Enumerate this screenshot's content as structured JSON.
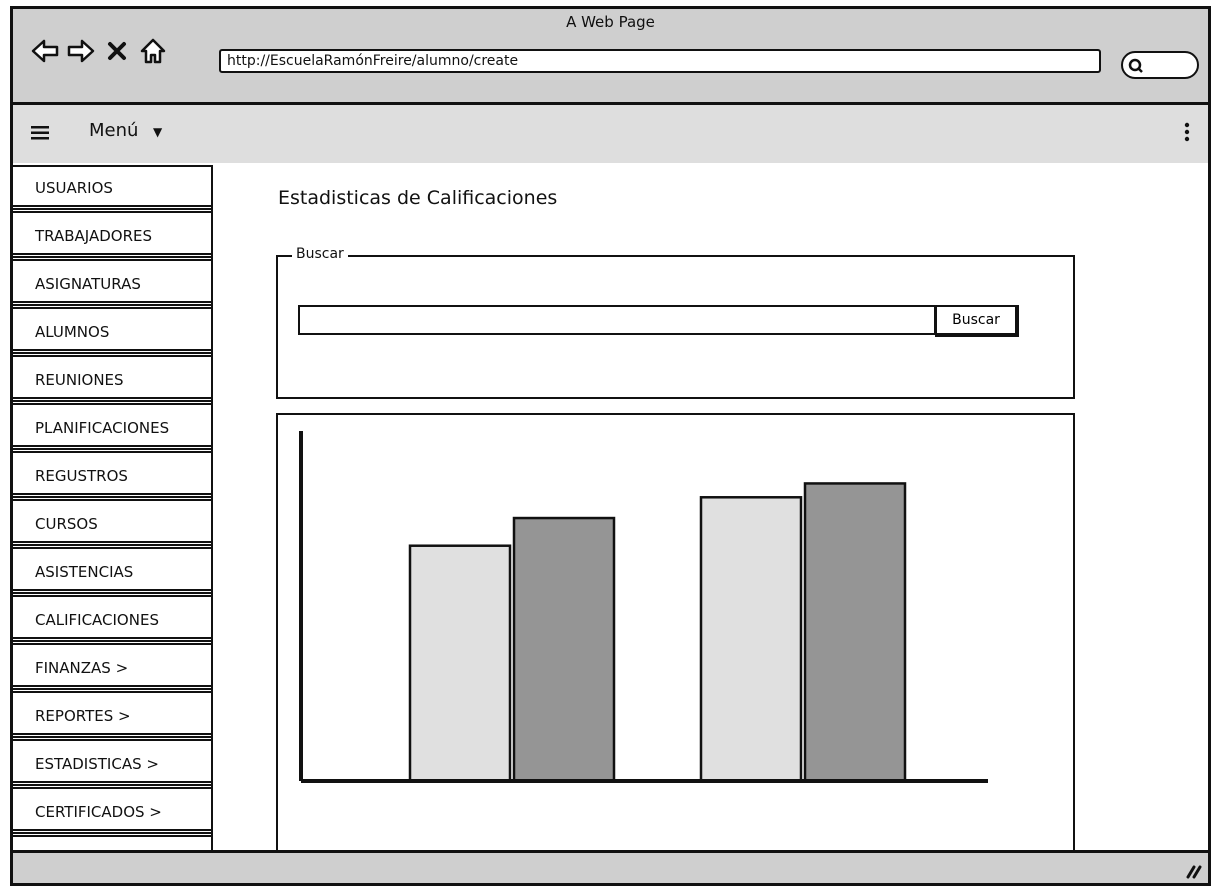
{
  "window": {
    "title": "A Web Page",
    "url": "http://EscuelaRamónFreire/alumno/create"
  },
  "icons": [
    "back-arrow-icon",
    "forward-arrow-icon",
    "close-x-icon",
    "home-icon",
    "search-icon",
    "hamburger-icon",
    "chevron-down-icon",
    "kebab-icon",
    "resize-grip-icon"
  ],
  "menubar": {
    "label": "Menú"
  },
  "sidebar": {
    "items": [
      {
        "label": "USUARIOS"
      },
      {
        "label": "TRABAJADORES"
      },
      {
        "label": "ASIGNATURAS"
      },
      {
        "label": "ALUMNOS"
      },
      {
        "label": "REUNIONES"
      },
      {
        "label": "PLANIFICACIONES"
      },
      {
        "label": "REGUSTROS"
      },
      {
        "label": "CURSOS"
      },
      {
        "label": "ASISTENCIAS"
      },
      {
        "label": "CALIFICACIONES"
      },
      {
        "label": "FINANZAS >"
      },
      {
        "label": "REPORTES >"
      },
      {
        "label": "ESTADISTICAS >"
      },
      {
        "label": "CERTIFICADOS >"
      }
    ]
  },
  "main": {
    "title": "Estadisticas de Calificaciones",
    "search": {
      "legend": "Buscar",
      "value": "",
      "button_label": "Buscar"
    }
  },
  "chart_data": {
    "type": "bar",
    "categories": [
      "",
      ""
    ],
    "series": [
      {
        "values": [
          68,
          82
        ],
        "color": "#e0e0e0"
      },
      {
        "values": [
          76,
          86
        ],
        "color": "#959595"
      }
    ],
    "ylim": [
      0,
      100
    ],
    "title": "",
    "xlabel": "",
    "ylabel": "",
    "grid": false,
    "colors": {
      "light": "#e0e0e0",
      "dark": "#959595"
    }
  },
  "colors": {
    "chrome": "#cfcfcf",
    "menubar": "#dedede",
    "border": "#111111"
  }
}
